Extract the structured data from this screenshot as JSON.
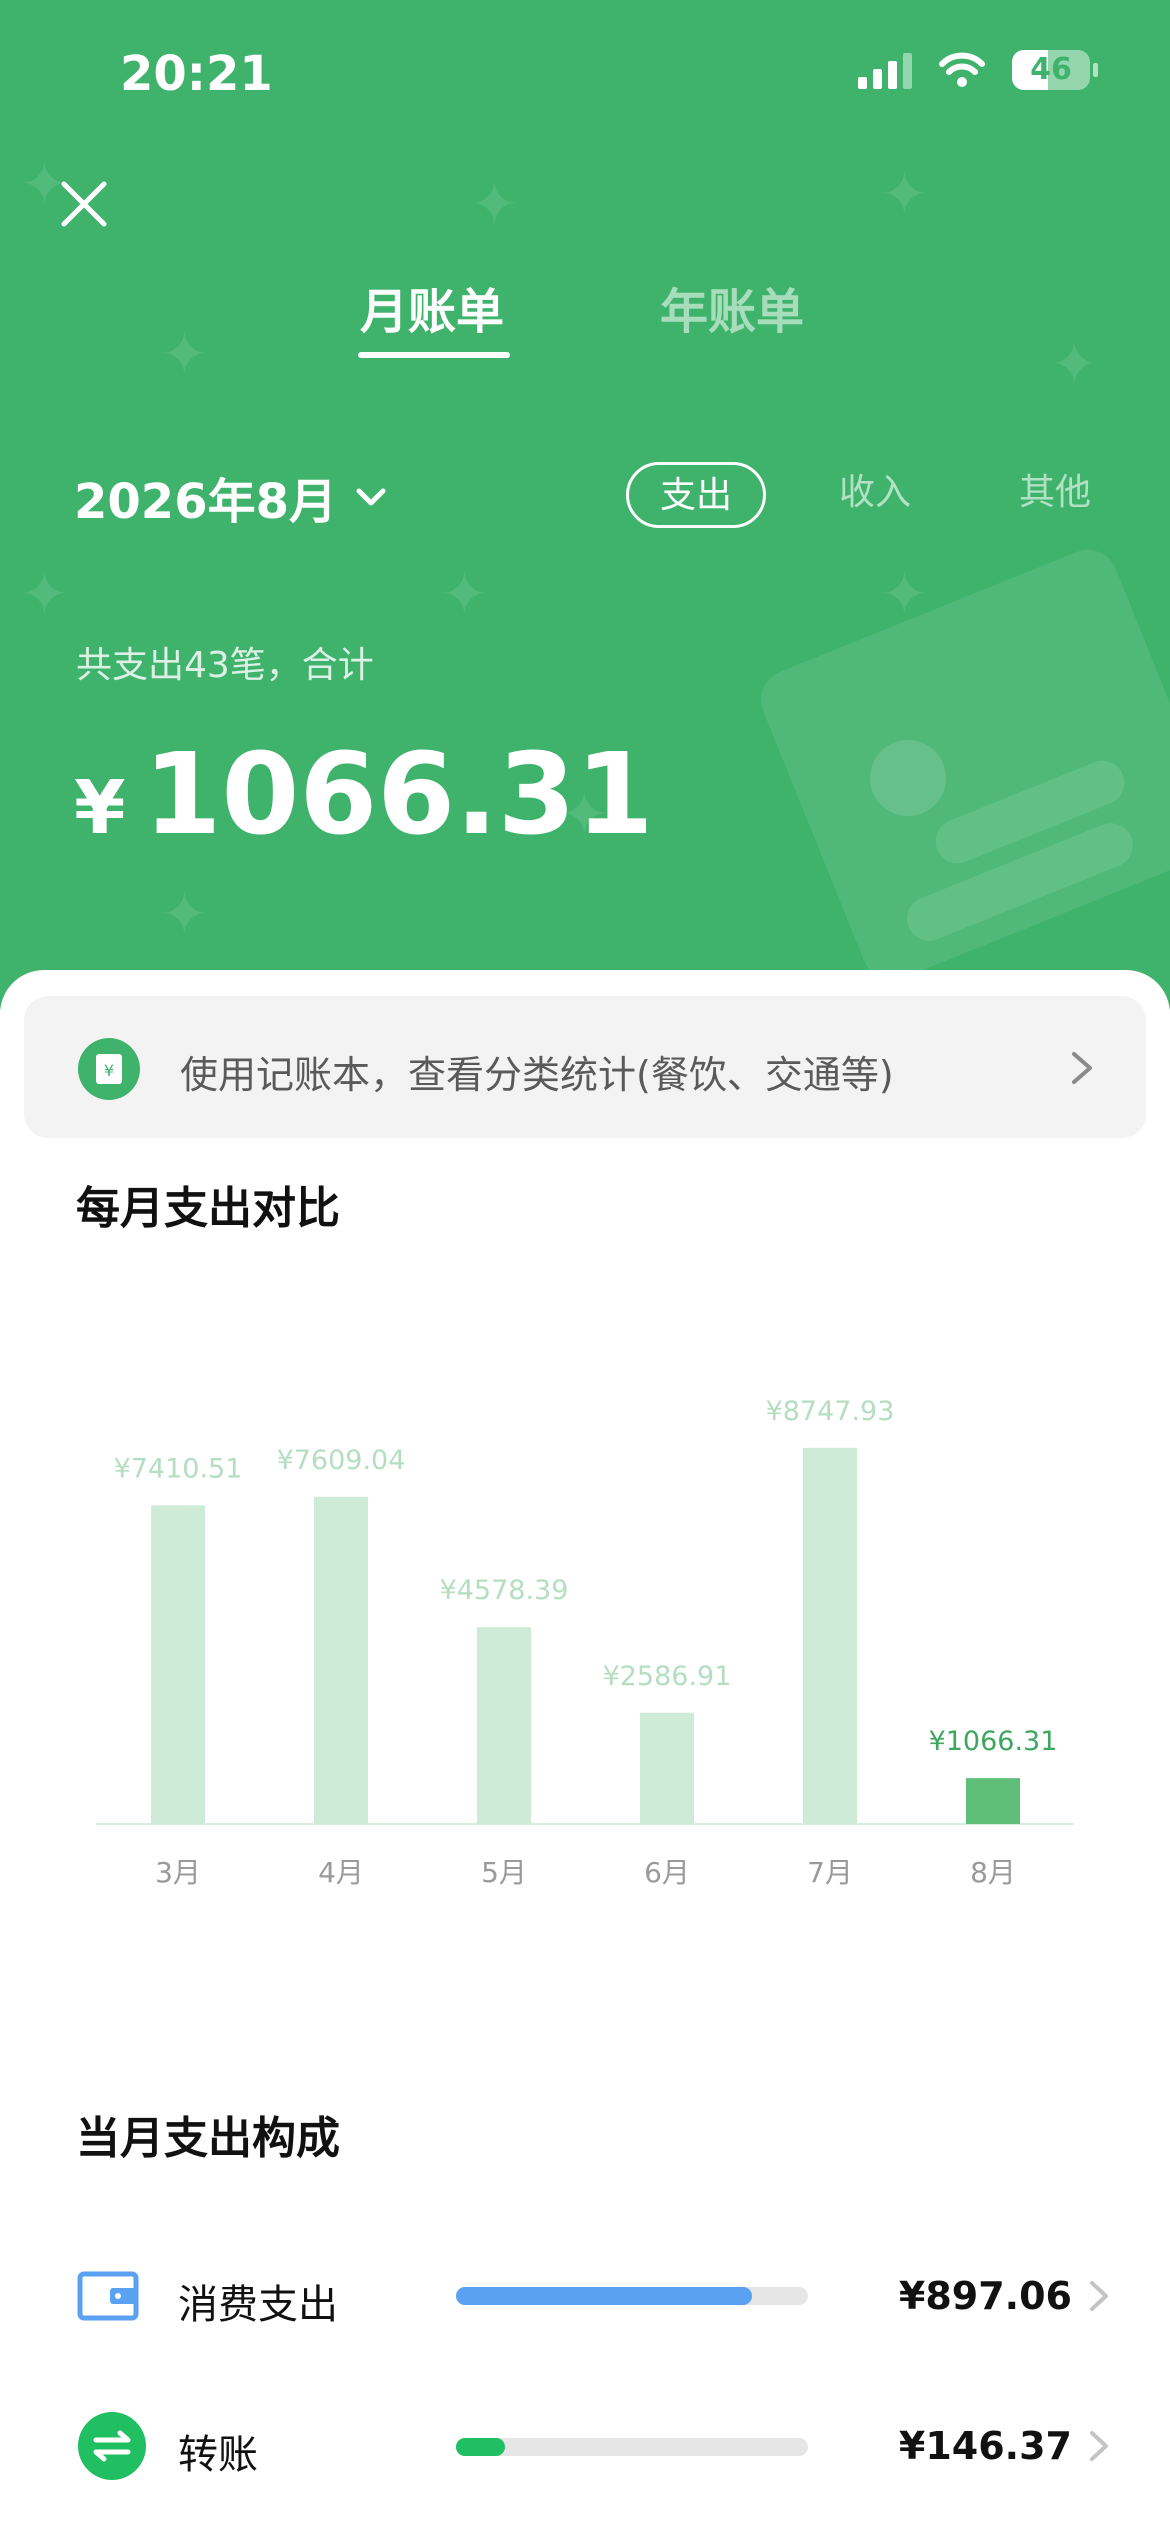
{
  "status_bar": {
    "time": "20:21",
    "battery": "46"
  },
  "tabs": [
    {
      "label": "月账单",
      "active": true
    },
    {
      "label": "年账单",
      "active": false
    }
  ],
  "filter": {
    "month": "2026年8月",
    "types": [
      {
        "label": "支出",
        "active": true
      },
      {
        "label": "收入",
        "active": false
      },
      {
        "label": "其他",
        "active": false
      }
    ]
  },
  "summary": {
    "text": "共支出43笔，合计",
    "currency": "¥",
    "amount": "1066.31"
  },
  "banner": {
    "text": "使用记账本，查看分类统计(餐饮、交通等)"
  },
  "monthly_comparison": {
    "title": "每月支出对比"
  },
  "chart_data": {
    "type": "bar",
    "categories": [
      "3月",
      "4月",
      "5月",
      "6月",
      "7月",
      "8月"
    ],
    "values": [
      7410.51,
      7609.04,
      4578.39,
      2586.91,
      8747.93,
      1066.31
    ],
    "labels": [
      "¥7410.51",
      "¥7609.04",
      "¥4578.39",
      "¥2586.91",
      "¥8747.93",
      "¥1066.31"
    ],
    "highlight_index": 5,
    "ylim": [
      0,
      10000
    ],
    "colors": {
      "bar": "#cdebd6",
      "highlight": "#5fbf79",
      "label": "#b5dec1",
      "highlight_label": "#3fa660",
      "axis": "#d8eedd",
      "tick": "#9a9a9a"
    }
  },
  "breakdown": {
    "title": "当月支出构成",
    "items": [
      {
        "label": "消费支出",
        "amount": "¥897.06",
        "share": 0.84,
        "color": "#5aa1f2"
      },
      {
        "label": "转账",
        "amount": "¥146.37",
        "share": 0.14,
        "color": "#1fbf62"
      }
    ]
  },
  "colors": {
    "header_green": "#3fb36c"
  }
}
